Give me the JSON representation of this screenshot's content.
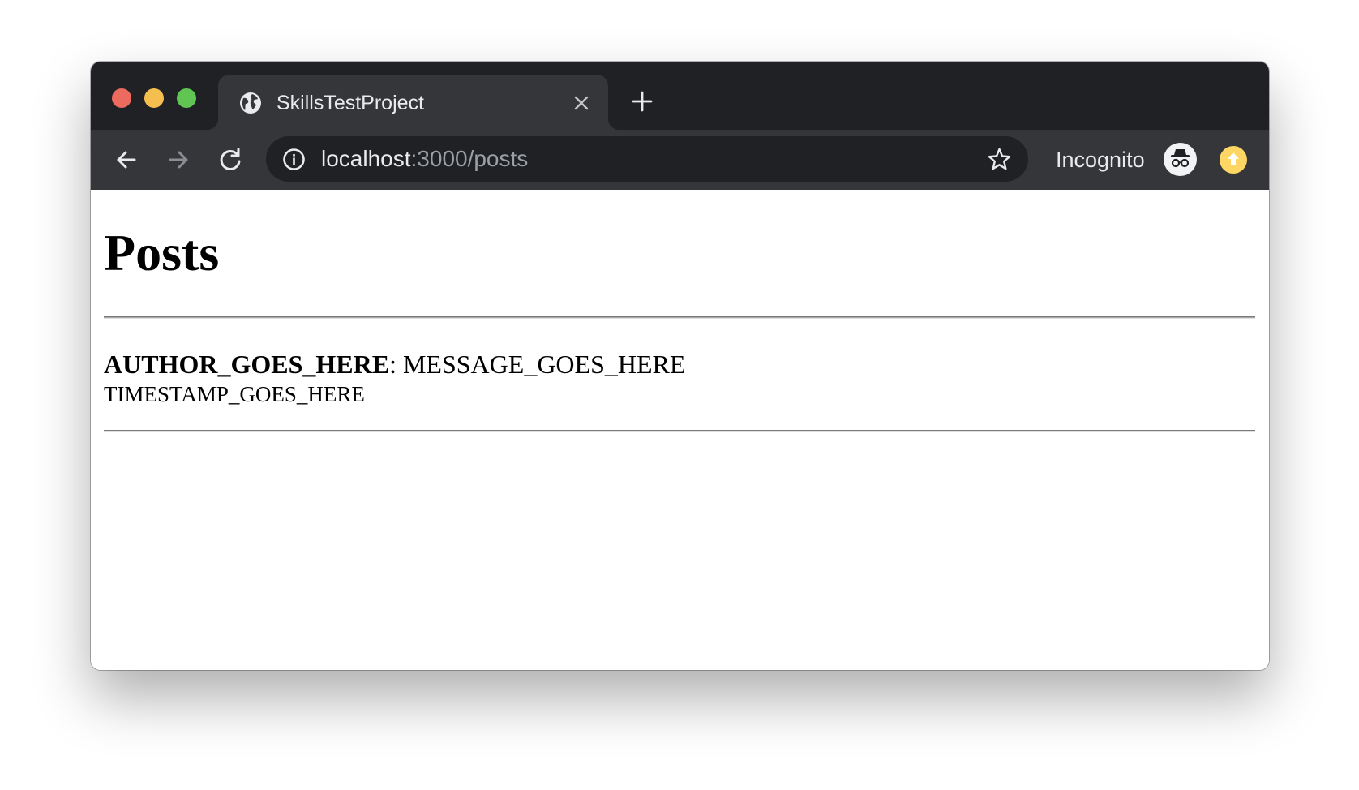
{
  "browser": {
    "tab": {
      "title": "SkillsTestProject",
      "favicon": "globe-icon",
      "close_icon": "close-icon"
    },
    "new_tab_icon": "plus-icon",
    "toolbar": {
      "back_icon": "arrow-left-icon",
      "forward_icon": "arrow-right-icon",
      "reload_icon": "reload-icon",
      "address": {
        "info_icon": "info-icon",
        "host": "localhost",
        "rest": ":3000/posts",
        "bookmark_icon": "star-icon"
      },
      "profile_label": "Incognito",
      "profile_icon": "incognito-icon",
      "update_icon": "update-arrow-icon"
    },
    "window_controls": {
      "close_color": "#ed6a5e",
      "minimize_color": "#f5bf4f",
      "zoom_color": "#61c554"
    }
  },
  "page": {
    "title": "Posts",
    "posts": [
      {
        "author": "AUTHOR_GOES_HERE",
        "separator": ": ",
        "message": "MESSAGE_GOES_HERE",
        "timestamp": "TIMESTAMP_GOES_HERE"
      }
    ]
  },
  "colors": {
    "tabstrip_bg": "#202124",
    "toolbar_bg": "#35363a",
    "omnibox_bg": "#202124",
    "text_light": "#e8eaed",
    "text_muted": "#9aa0a6",
    "update_badge": "#fdd663"
  }
}
